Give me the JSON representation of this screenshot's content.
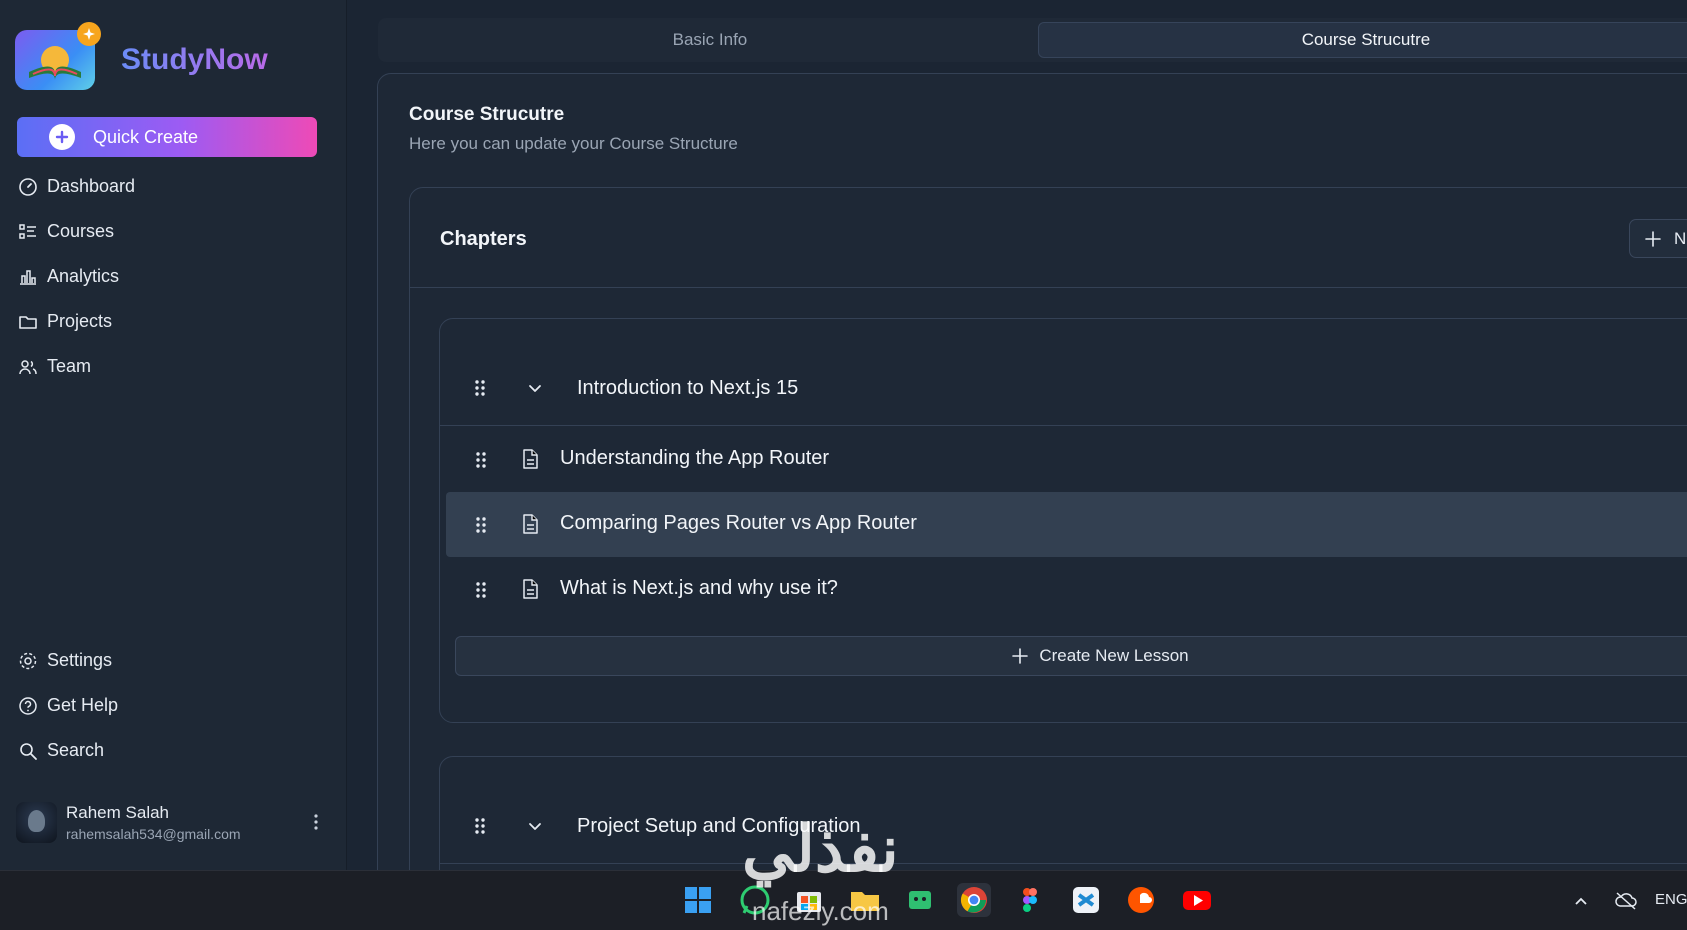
{
  "brand": {
    "name": "StudyNow"
  },
  "sidebar": {
    "quick_create": "Quick Create",
    "nav_top": [
      {
        "label": "Dashboard",
        "icon": "gauge-icon"
      },
      {
        "label": "Courses",
        "icon": "list-icon"
      },
      {
        "label": "Analytics",
        "icon": "bar-chart-icon"
      },
      {
        "label": "Projects",
        "icon": "folder-icon"
      },
      {
        "label": "Team",
        "icon": "users-icon"
      }
    ],
    "nav_bottom": [
      {
        "label": "Settings",
        "icon": "gear-icon"
      },
      {
        "label": "Get Help",
        "icon": "help-circle-icon"
      },
      {
        "label": "Search",
        "icon": "search-icon"
      }
    ],
    "user": {
      "name": "Rahem Salah",
      "email": "rahemsalah534@gmail.com"
    }
  },
  "tabs": [
    {
      "label": "Basic Info",
      "active": false
    },
    {
      "label": "Course Strucutre",
      "active": true
    }
  ],
  "card": {
    "title": "Course Strucutre",
    "subtitle": "Here you can update your Course Structure"
  },
  "chapters": {
    "title": "Chapters",
    "new_button": "Ne",
    "items": [
      {
        "title": "Introduction to Next.js 15",
        "lessons": [
          "Understanding the App Router",
          "Comparing Pages Router vs App Router",
          "What is Next.js and why use it?"
        ],
        "create_lesson": "Create New Lesson"
      },
      {
        "title": "Project Setup and Configuration"
      }
    ]
  },
  "watermark": {
    "arabic": "نفذلي",
    "latin": "nafezly.com"
  },
  "taskbar": {
    "language": "ENG"
  },
  "colors": {
    "accent_start": "#5b6ff5",
    "accent_end": "#ee4ab6",
    "background": "#1b2533"
  }
}
